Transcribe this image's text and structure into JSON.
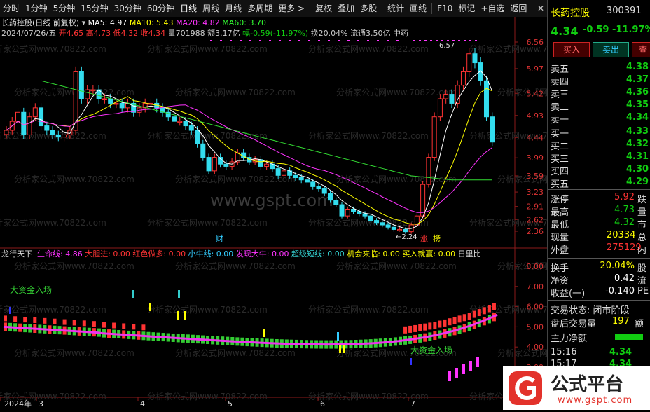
{
  "toolbar": {
    "items": [
      "分时",
      "1分钟",
      "5分钟",
      "15分钟",
      "30分钟",
      "60分钟",
      "日线",
      "周线",
      "月线",
      "多周期",
      "更多 >",
      "复权",
      "叠加",
      "多股",
      "统计",
      "画线",
      "F10",
      "标记",
      "+自选",
      "返回"
    ],
    "close": "✕"
  },
  "main_header": {
    "title": "长药控股(日线 前复权)",
    "ma5": "MA5: 4.97",
    "ma10": "MA10: 5.43",
    "ma20": "MA20: 4.82",
    "ma60": "MA60: 3.70"
  },
  "ohlc_line": {
    "date": "2024/07/26/五",
    "open": "开4.65",
    "high": "高4.73",
    "low": "低4.32",
    "close": "收4.34",
    "volume": "量701988",
    "amount": "额3.17亿",
    "change": "幅-0.59(-11.97%)",
    "turnover": "换20.04%",
    "float": "流通3.50亿",
    "sector": "中药"
  },
  "main_axis": [
    "6.56",
    "5.97",
    "5.42",
    "4.93",
    "4.44",
    "3.99",
    "3.59",
    "3.23",
    "2.91",
    "2.62",
    "2.36"
  ],
  "annotations": {
    "peak": "6.57",
    "low": "2.24",
    "cai": "财",
    "zhang": "涨",
    "bang": "榜",
    "big_fund_1": "大资金入场",
    "big_fund_2": "大资金入场"
  },
  "indicator_header": {
    "name": "龙行天下",
    "lifeline": "生命线: 4.86",
    "dadan": "大胆进: 0.00",
    "hongse": "红色做多: 0.00",
    "xiaoniu": "小牛线: 0.00",
    "faxian": "发现大牛: 0.00",
    "chaoji": "超级短线: 0.00",
    "jihui": "机会来临: 0.00",
    "mairu": "买入就赢: 0.00",
    "rili": "日里比"
  },
  "ind_axis": [
    "8.00",
    "7.00",
    "6.00",
    "5.00",
    "4.00",
    "3.00"
  ],
  "x_axis": [
    "2024年",
    "3",
    "4",
    "5",
    "6",
    "7"
  ],
  "watermark": "分析家公式网www.70822.com",
  "panel": {
    "name": "长药控股",
    "code": "300391",
    "price": "4.34",
    "chg": "-0.59",
    "pct": "-11.97%",
    "buy_btn": "买入",
    "sell_btn": "卖出",
    "more_btn": "查",
    "asks": [
      {
        "label": "卖五",
        "price": "4.38"
      },
      {
        "label": "卖四",
        "price": "4.37"
      },
      {
        "label": "卖三",
        "price": "4.36"
      },
      {
        "label": "卖二",
        "price": "4.35"
      },
      {
        "label": "卖一",
        "price": "4.34"
      }
    ],
    "bids": [
      {
        "label": "买一",
        "price": "4.33"
      },
      {
        "label": "买二",
        "price": "4.32"
      },
      {
        "label": "买三",
        "price": "4.31"
      },
      {
        "label": "买四",
        "price": "4.30"
      },
      {
        "label": "买五",
        "price": "4.29"
      }
    ],
    "stats": [
      {
        "label": "涨停",
        "value": "5.92",
        "tail": "跌"
      },
      {
        "label": "最高",
        "value": "4.73",
        "tail": "量"
      },
      {
        "label": "最低",
        "value": "4.32",
        "tail": "市"
      },
      {
        "label": "现量",
        "value": "20334",
        "tail": "总"
      },
      {
        "label": "外盘",
        "value": "275129",
        "tail": "内"
      }
    ],
    "stats2": [
      {
        "label": "换手",
        "value": "20.04%",
        "tail": "股"
      },
      {
        "label": "净资",
        "value": "0.42",
        "tail": "流"
      },
      {
        "label": "收益(一)",
        "value": "-0.140",
        "tail": "PE"
      }
    ],
    "trade_status": "交易状态: 闭市阶段",
    "after_hours": "盘后交易量",
    "after_val": "197",
    "after_tail": "额",
    "main_flow": "主力净额",
    "ticks": [
      {
        "time": "15:16",
        "price": "4.34"
      },
      {
        "time": "15:17",
        "price": "4.34"
      }
    ]
  },
  "logo": {
    "text": "公式平台",
    "url": "www.gspt.com"
  },
  "center_watermark": "www.gspt.com"
}
